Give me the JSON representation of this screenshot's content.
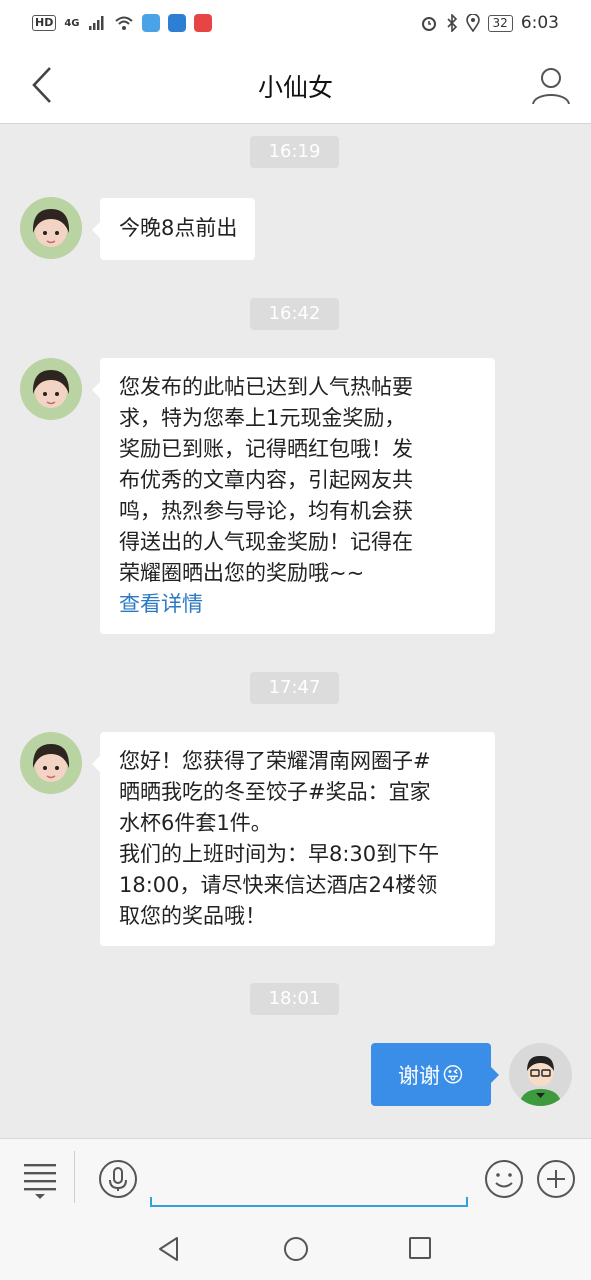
{
  "status_bar": {
    "hd": "HD",
    "network": "4G",
    "battery": "32",
    "time": "6:03"
  },
  "header": {
    "title": "小仙女"
  },
  "messages": [
    {
      "time": "16:19",
      "text": "今晚8点前出"
    },
    {
      "time": "16:42",
      "text": "您发布的此帖已达到人气热帖要\n求，特为您奉上1元现金奖励，\n奖励已到账，记得晒红包哦！发\n布优秀的文章内容，引起网友共\n鸣，热烈参与导论，均有机会获\n得送出的人气现金奖励！记得在\n荣耀圈晒出您的奖励哦~~",
      "link": "查看详情"
    },
    {
      "time": "17:47",
      "text": "您好！您获得了荣耀渭南网圈子#\n晒晒我吃的冬至饺子#奖品：宜家\n水杯6件套1件。\n我们的上班时间为：早8:30到下午\n18:00，请尽快来信达酒店24楼领\n取您的奖品哦！"
    },
    {
      "time": "18:01",
      "text": "谢谢",
      "emoji": "😜",
      "outgoing": true
    }
  ],
  "colors": {
    "accent_blue": "#3b8ee8",
    "link_blue": "#2b79c2",
    "input_underline": "#34a0d9",
    "chat_background": "#ebebeb"
  },
  "icons": {
    "back": "chevron-left-icon",
    "profile": "person-icon",
    "menu": "menu-icon",
    "voice": "microphone-icon",
    "emoji": "smiley-icon",
    "plus": "plus-icon",
    "nav_back": "triangle-back-icon",
    "nav_home": "circle-home-icon",
    "nav_recent": "square-recent-icon"
  }
}
